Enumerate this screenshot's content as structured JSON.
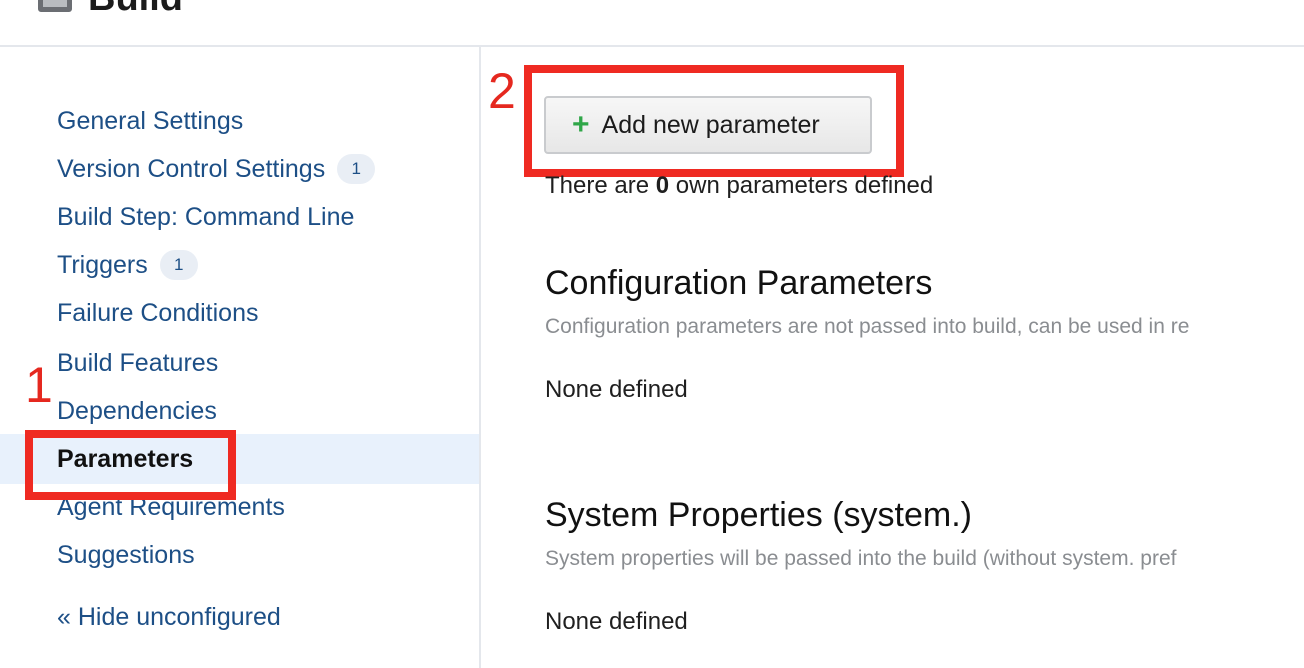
{
  "header": {
    "title": "Build"
  },
  "sidebar": {
    "items": [
      {
        "label": "General Settings"
      },
      {
        "label": "Version Control Settings",
        "badge": "1"
      },
      {
        "label": "Build Step: Command Line"
      },
      {
        "label": "Triggers",
        "badge": "1"
      },
      {
        "label": "Failure Conditions"
      },
      {
        "label": "Build Features"
      },
      {
        "label": "Dependencies"
      },
      {
        "label": "Parameters",
        "active": true
      },
      {
        "label": "Agent Requirements"
      },
      {
        "label": "Suggestions"
      }
    ],
    "hide_unconfigured": "« Hide unconfigured"
  },
  "annotations": {
    "one": "1",
    "two": "2",
    "color": "#ef2a22"
  },
  "main": {
    "add_button": {
      "icon": "plus-icon",
      "label": "Add new parameter"
    },
    "own_params": {
      "prefix": "There are",
      "count": "0",
      "suffix": "own parameters defined"
    },
    "sections": [
      {
        "title": "Configuration Parameters",
        "description": "Configuration parameters are not passed into build, can be used in re",
        "empty": "None defined"
      },
      {
        "title": "System Properties (system.)",
        "description": "System properties will be passed into the build (without system. pref",
        "empty": "None defined"
      }
    ]
  },
  "colors": {
    "link": "#1d4f86",
    "active_bg": "#e8f1fc",
    "annotation": "#ef2a22",
    "plus": "#2fa648"
  }
}
